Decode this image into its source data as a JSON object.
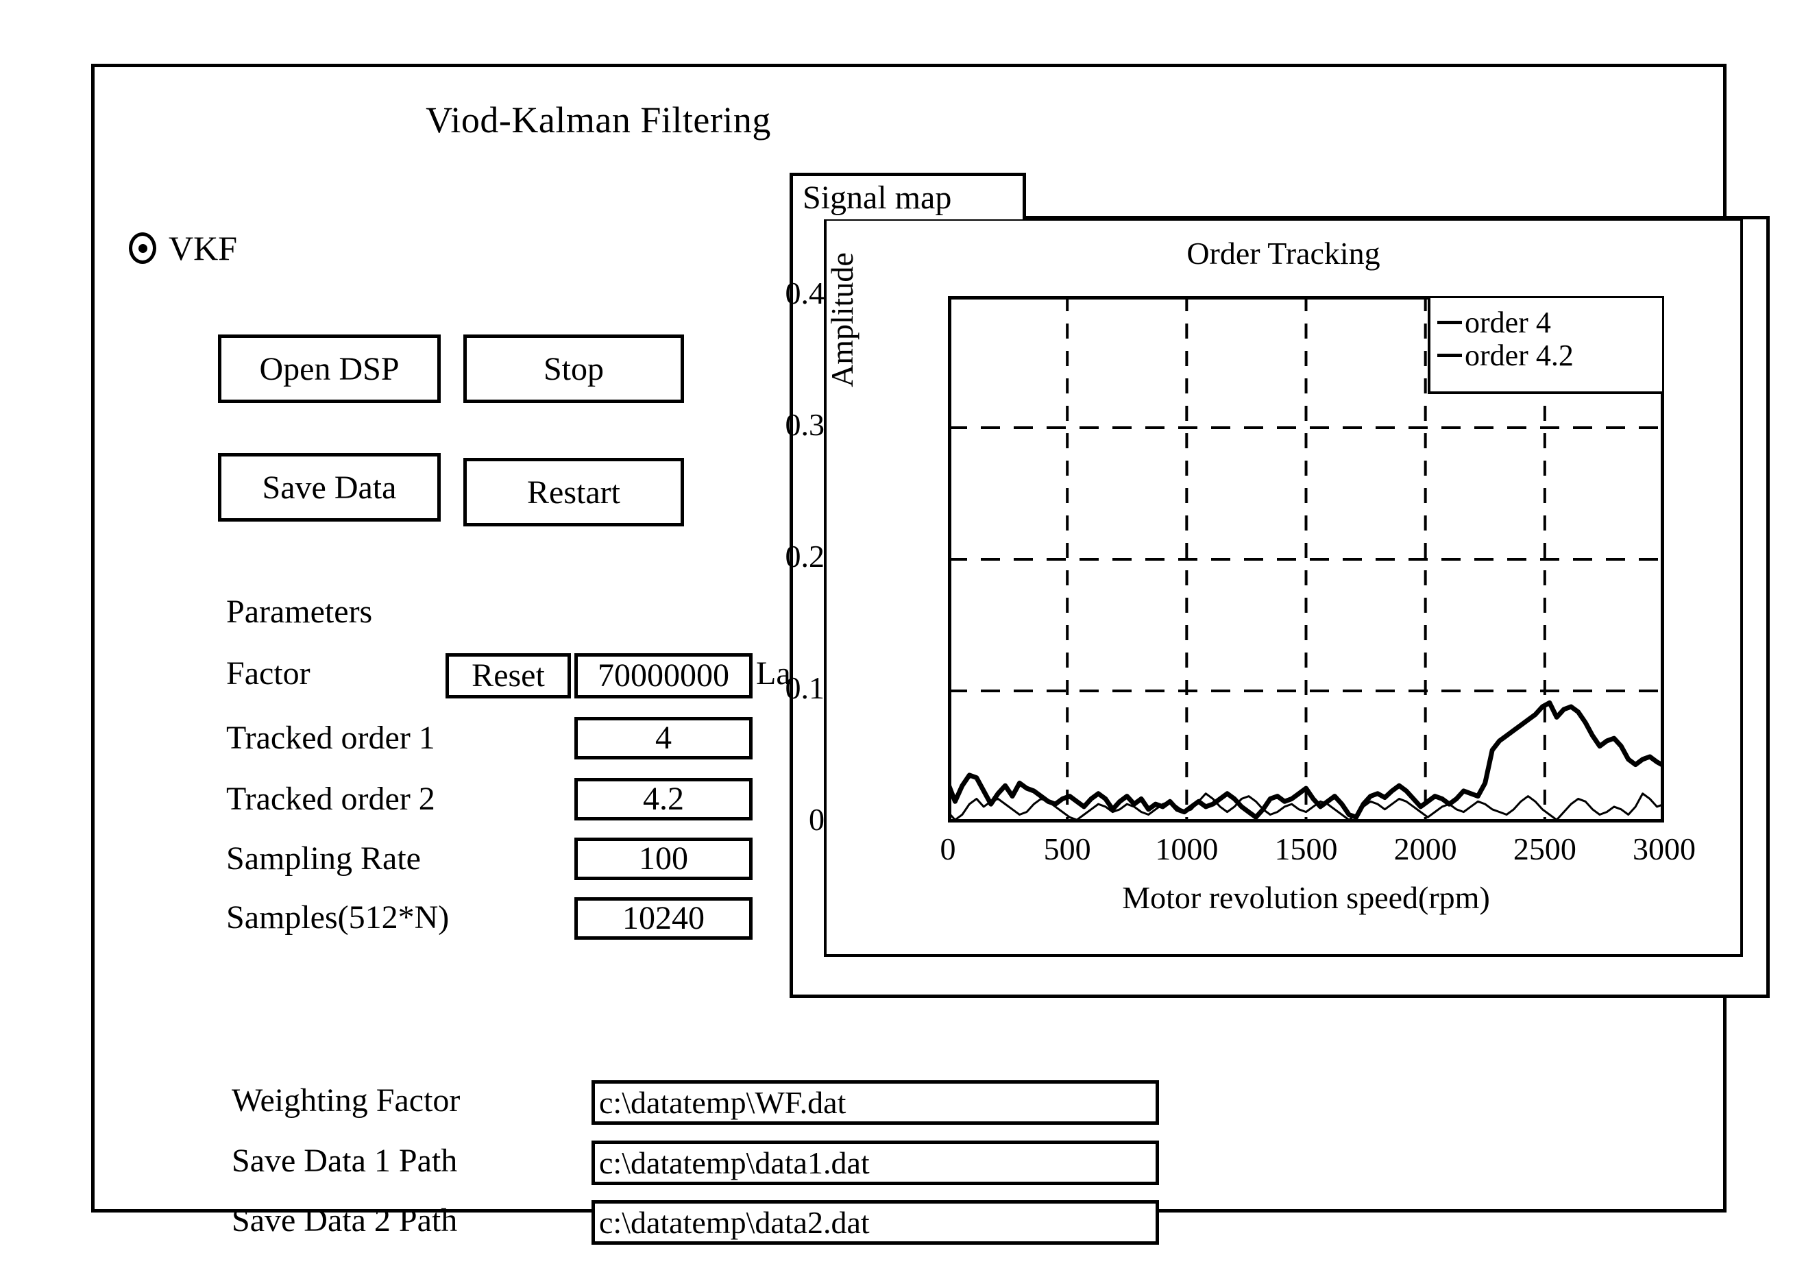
{
  "window": {
    "title": "Viod-Kalman Filtering"
  },
  "mode_selector": {
    "label": "VKF",
    "selected": true
  },
  "buttons": {
    "open_dsp": "Open DSP",
    "stop": "Stop",
    "save_data": "Save Data",
    "restart": "Restart",
    "reset": "Reset"
  },
  "parameters": {
    "heading": "Parameters",
    "factor": {
      "label": "Factor",
      "value": "70000000",
      "trailing_label": "LabelS"
    },
    "tracked_order_1": {
      "label": "Tracked order 1",
      "value": "4"
    },
    "tracked_order_2": {
      "label": "Tracked order 2",
      "value": "4.2"
    },
    "sampling_rate": {
      "label": "Sampling Rate",
      "value": "100"
    },
    "samples": {
      "label": "Samples(512*N)",
      "value": "10240"
    }
  },
  "paths": {
    "weighting_factor": {
      "label": "Weighting Factor",
      "value": "c:\\datatemp\\WF.dat"
    },
    "save_data_1": {
      "label": "Save Data 1 Path",
      "value": "c:\\datatemp\\data1.dat"
    },
    "save_data_2": {
      "label": "Save Data 2 Path",
      "value": "c:\\datatemp\\data2.dat"
    }
  },
  "signal_map": {
    "tab_label": "Signal map"
  },
  "chart_data": {
    "type": "line",
    "title": "Order Tracking",
    "xlabel": "Motor revolution speed(rpm)",
    "ylabel": "Amplitude",
    "xlim": [
      0,
      3000
    ],
    "ylim": [
      0,
      0.4
    ],
    "xticks": [
      0,
      500,
      1000,
      1500,
      2000,
      2500,
      3000
    ],
    "xtick_labels": [
      "0",
      "500",
      "1000",
      "1500",
      "2000",
      "2500",
      "3000"
    ],
    "yticks": [
      0,
      0.1,
      0.2,
      0.3,
      0.4
    ],
    "ytick_labels": [
      "0",
      "0.1",
      "0.2",
      "0.3",
      "0.4"
    ],
    "grid": "dashed-both",
    "legend_position": "top-right",
    "series": [
      {
        "name": "order 4",
        "color": "#000000",
        "line_width": 7,
        "x": [
          0,
          30,
          60,
          90,
          120,
          150,
          180,
          210,
          240,
          270,
          300,
          330,
          360,
          390,
          420,
          450,
          480,
          510,
          540,
          570,
          600,
          630,
          660,
          690,
          720,
          750,
          780,
          810,
          840,
          870,
          900,
          930,
          960,
          990,
          1020,
          1050,
          1080,
          1110,
          1140,
          1170,
          1200,
          1230,
          1260,
          1290,
          1320,
          1350,
          1380,
          1410,
          1440,
          1470,
          1500,
          1530,
          1560,
          1590,
          1620,
          1650,
          1680,
          1710,
          1740,
          1770,
          1800,
          1830,
          1860,
          1890,
          1920,
          1950,
          1980,
          2010,
          2040,
          2070,
          2100,
          2130,
          2160,
          2190,
          2220,
          2250,
          2280,
          2310,
          2340,
          2370,
          2400,
          2430,
          2460,
          2490,
          2520,
          2550,
          2580,
          2610,
          2640,
          2670,
          2700,
          2730,
          2760,
          2790,
          2820,
          2850,
          2880,
          2910,
          2940,
          2970,
          3000
        ],
        "y": [
          0.03,
          0.016,
          0.028,
          0.036,
          0.034,
          0.024,
          0.014,
          0.022,
          0.028,
          0.02,
          0.03,
          0.026,
          0.024,
          0.02,
          0.016,
          0.014,
          0.018,
          0.02,
          0.016,
          0.012,
          0.018,
          0.022,
          0.018,
          0.01,
          0.016,
          0.02,
          0.014,
          0.018,
          0.01,
          0.014,
          0.012,
          0.016,
          0.01,
          0.008,
          0.012,
          0.016,
          0.012,
          0.014,
          0.018,
          0.022,
          0.018,
          0.012,
          0.008,
          0.004,
          0.01,
          0.018,
          0.02,
          0.016,
          0.018,
          0.022,
          0.026,
          0.018,
          0.012,
          0.016,
          0.02,
          0.014,
          0.006,
          0.004,
          0.014,
          0.02,
          0.022,
          0.019,
          0.024,
          0.028,
          0.024,
          0.018,
          0.012,
          0.016,
          0.02,
          0.018,
          0.014,
          0.018,
          0.024,
          0.022,
          0.02,
          0.03,
          0.055,
          0.062,
          0.066,
          0.07,
          0.074,
          0.078,
          0.082,
          0.088,
          0.091,
          0.08,
          0.086,
          0.088,
          0.084,
          0.076,
          0.066,
          0.058,
          0.062,
          0.064,
          0.058,
          0.048,
          0.044,
          0.048,
          0.05,
          0.046,
          0.043
        ]
      },
      {
        "name": "order 4.2",
        "color": "#000000",
        "line_width": 3,
        "x": [
          0,
          30,
          60,
          90,
          120,
          150,
          180,
          210,
          240,
          270,
          300,
          330,
          360,
          390,
          420,
          450,
          480,
          510,
          540,
          570,
          600,
          630,
          660,
          690,
          720,
          750,
          780,
          810,
          840,
          870,
          900,
          930,
          960,
          990,
          1020,
          1050,
          1080,
          1110,
          1140,
          1170,
          1200,
          1230,
          1260,
          1290,
          1320,
          1350,
          1380,
          1410,
          1440,
          1470,
          1500,
          1530,
          1560,
          1590,
          1620,
          1650,
          1680,
          1710,
          1740,
          1770,
          1800,
          1830,
          1860,
          1890,
          1920,
          1950,
          1980,
          2010,
          2040,
          2070,
          2100,
          2130,
          2160,
          2190,
          2220,
          2250,
          2280,
          2310,
          2340,
          2370,
          2400,
          2430,
          2460,
          2490,
          2520,
          2550,
          2580,
          2610,
          2640,
          2670,
          2700,
          2730,
          2760,
          2790,
          2820,
          2850,
          2880,
          2910,
          2940,
          2970,
          3000
        ],
        "y": [
          0.008,
          0.002,
          0.006,
          0.014,
          0.018,
          0.012,
          0.016,
          0.018,
          0.014,
          0.01,
          0.006,
          0.008,
          0.014,
          0.018,
          0.016,
          0.012,
          0.008,
          0.004,
          0.002,
          0.006,
          0.01,
          0.014,
          0.012,
          0.008,
          0.01,
          0.014,
          0.012,
          0.008,
          0.006,
          0.01,
          0.014,
          0.016,
          0.012,
          0.008,
          0.01,
          0.016,
          0.022,
          0.018,
          0.012,
          0.008,
          0.012,
          0.018,
          0.02,
          0.016,
          0.01,
          0.006,
          0.008,
          0.012,
          0.014,
          0.01,
          0.008,
          0.012,
          0.016,
          0.014,
          0.01,
          0.006,
          0.002,
          0.006,
          0.012,
          0.016,
          0.014,
          0.01,
          0.014,
          0.018,
          0.016,
          0.012,
          0.008,
          0.004,
          0.008,
          0.012,
          0.014,
          0.01,
          0.008,
          0.012,
          0.016,
          0.014,
          0.01,
          0.008,
          0.006,
          0.01,
          0.016,
          0.02,
          0.016,
          0.01,
          0.006,
          0.002,
          0.008,
          0.014,
          0.018,
          0.016,
          0.01,
          0.006,
          0.008,
          0.012,
          0.01,
          0.006,
          0.012,
          0.022,
          0.018,
          0.012,
          0.014
        ]
      }
    ],
    "legend": [
      {
        "dash": "—",
        "label": "order 4"
      },
      {
        "dash": "—",
        "label": "order 4.2"
      }
    ]
  }
}
